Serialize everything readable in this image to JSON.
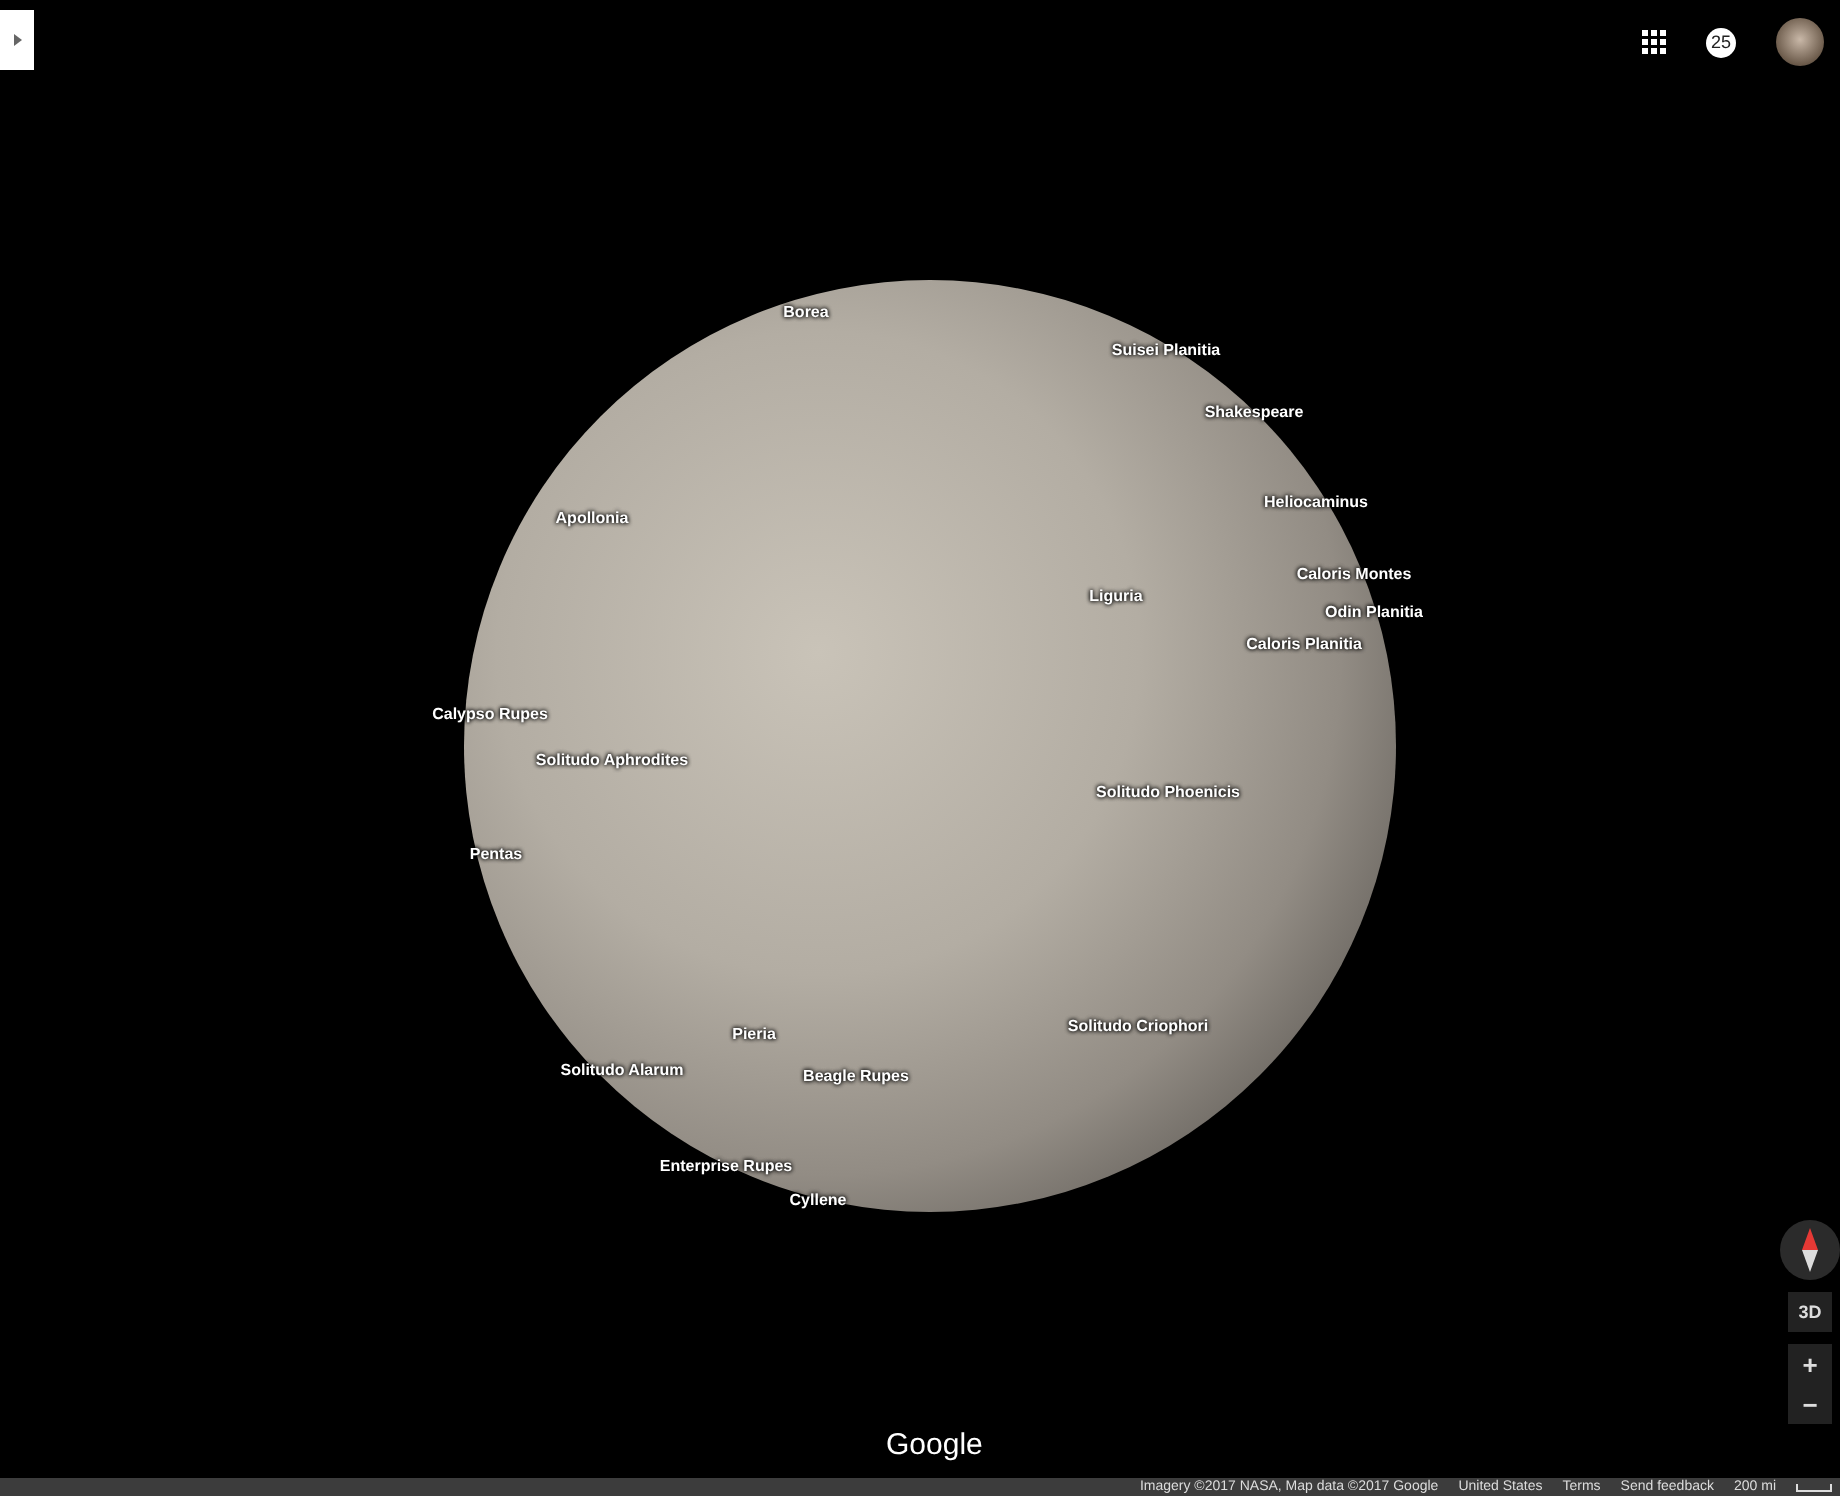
{
  "top_bar": {
    "notification_count": "25"
  },
  "planet_labels": [
    "Borea",
    "Suisei Planitia",
    "Shakespeare",
    "Heliocaminus",
    "Apollonia",
    "Caloris Montes",
    "Liguria",
    "Odin Planitia",
    "Caloris Planitia",
    "Calypso Rupes",
    "Solitudo Aphrodites",
    "Solitudo Phoenicis",
    "Pentas",
    "Pieria",
    "Solitudo Criophori",
    "Solitudo Alarum",
    "Beagle Rupes",
    "Enterprise Rupes",
    "Cyllene"
  ],
  "controls": {
    "view_toggle": "3D",
    "zoom_in": "+",
    "zoom_out": "−"
  },
  "logo": "Google",
  "footer": {
    "attribution": "Imagery ©2017 NASA, Map data ©2017 Google",
    "links": [
      "United States",
      "Terms",
      "Send feedback"
    ],
    "scale": "200 mi"
  }
}
